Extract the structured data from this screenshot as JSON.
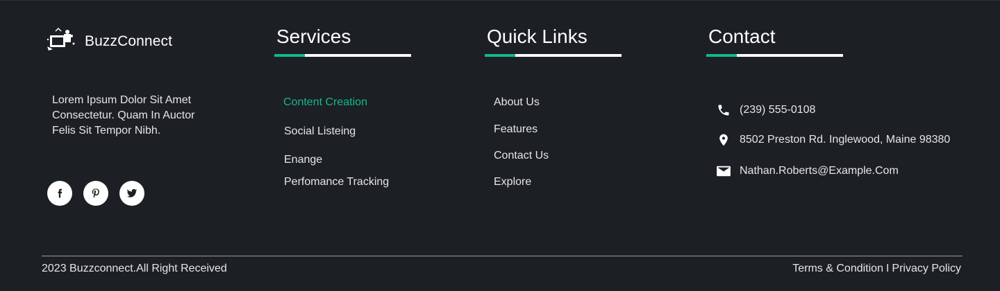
{
  "brand": {
    "name": "BuzzConnect"
  },
  "about": {
    "text": "Lorem Ipsum Dolor Sit Amet Consectetur. Quam In Auctor Felis Sit Tempor Nibh."
  },
  "socials": [
    {
      "icon": "facebook-icon",
      "glyph": "f"
    },
    {
      "icon": "pinterest-icon",
      "glyph": "P"
    },
    {
      "icon": "twitter-icon",
      "glyph": "t"
    }
  ],
  "services": {
    "title": "Services",
    "items": [
      "Content Creation",
      "Social Listeing",
      "Enange",
      "Perfomance Tracking"
    ],
    "active_index": 0
  },
  "quick_links": {
    "title": "Quick Links",
    "items": [
      "About Us",
      "Features",
      "Contact Us",
      "Explore"
    ]
  },
  "contact": {
    "title": "Contact",
    "phone": "(239) 555-0108",
    "address": "8502 Preston Rd. Inglewood, Maine 98380",
    "email": "Nathan.Roberts@Example.Com"
  },
  "bottom": {
    "copyright": "2023 Buzzconnect.All Right Received",
    "terms": "Terms & Condition",
    "separator": "I",
    "privacy": "Privacy Policy"
  },
  "colors": {
    "background": "#1c1f23",
    "accent": "#10b98a",
    "text": "#e6e6e6"
  }
}
